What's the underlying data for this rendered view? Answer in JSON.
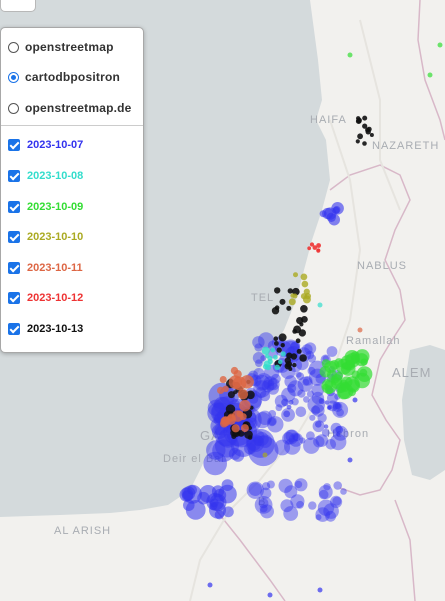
{
  "map": {
    "places": [
      {
        "name": "HAIFA",
        "label": "HAIFA"
      },
      {
        "name": "NAZARETH",
        "label": "NAZARETH"
      },
      {
        "name": "NABLUS",
        "label": "NABLUS"
      },
      {
        "name": "TEL",
        "label": "TEL"
      },
      {
        "name": "Ramallah",
        "label": "Ramallah"
      },
      {
        "name": "ALEM",
        "label": "ALEM"
      },
      {
        "name": "Hebron",
        "label": "Hebron"
      },
      {
        "name": "GA",
        "label": "GA"
      },
      {
        "name": "Deir el Bal",
        "label": "Deir el Bal"
      },
      {
        "name": "B",
        "label": "B"
      },
      {
        "name": "AL ARISH",
        "label": "AL ARISH"
      }
    ],
    "colors": {
      "sea": "#d4dadc",
      "land": "#f2f1ee",
      "border": "#d8b8c8"
    }
  },
  "layer_control": {
    "base_layers": [
      {
        "label": "openstreetmap",
        "selected": false
      },
      {
        "label": "cartodbpositron",
        "selected": true
      },
      {
        "label": "openstreetmap.de",
        "selected": false
      }
    ],
    "overlays": [
      {
        "label": "2023-10-07",
        "checked": true,
        "color": "#3333ee"
      },
      {
        "label": "2023-10-08",
        "checked": true,
        "color": "#33ddcc"
      },
      {
        "label": "2023-10-09",
        "checked": true,
        "color": "#33dd33"
      },
      {
        "label": "2023-10-10",
        "checked": true,
        "color": "#aaaa22"
      },
      {
        "label": "2023-10-11",
        "checked": true,
        "color": "#dd6644"
      },
      {
        "label": "2023-10-12",
        "checked": true,
        "color": "#ee3333"
      },
      {
        "label": "2023-10-13",
        "checked": true,
        "color": "#111111"
      }
    ]
  }
}
